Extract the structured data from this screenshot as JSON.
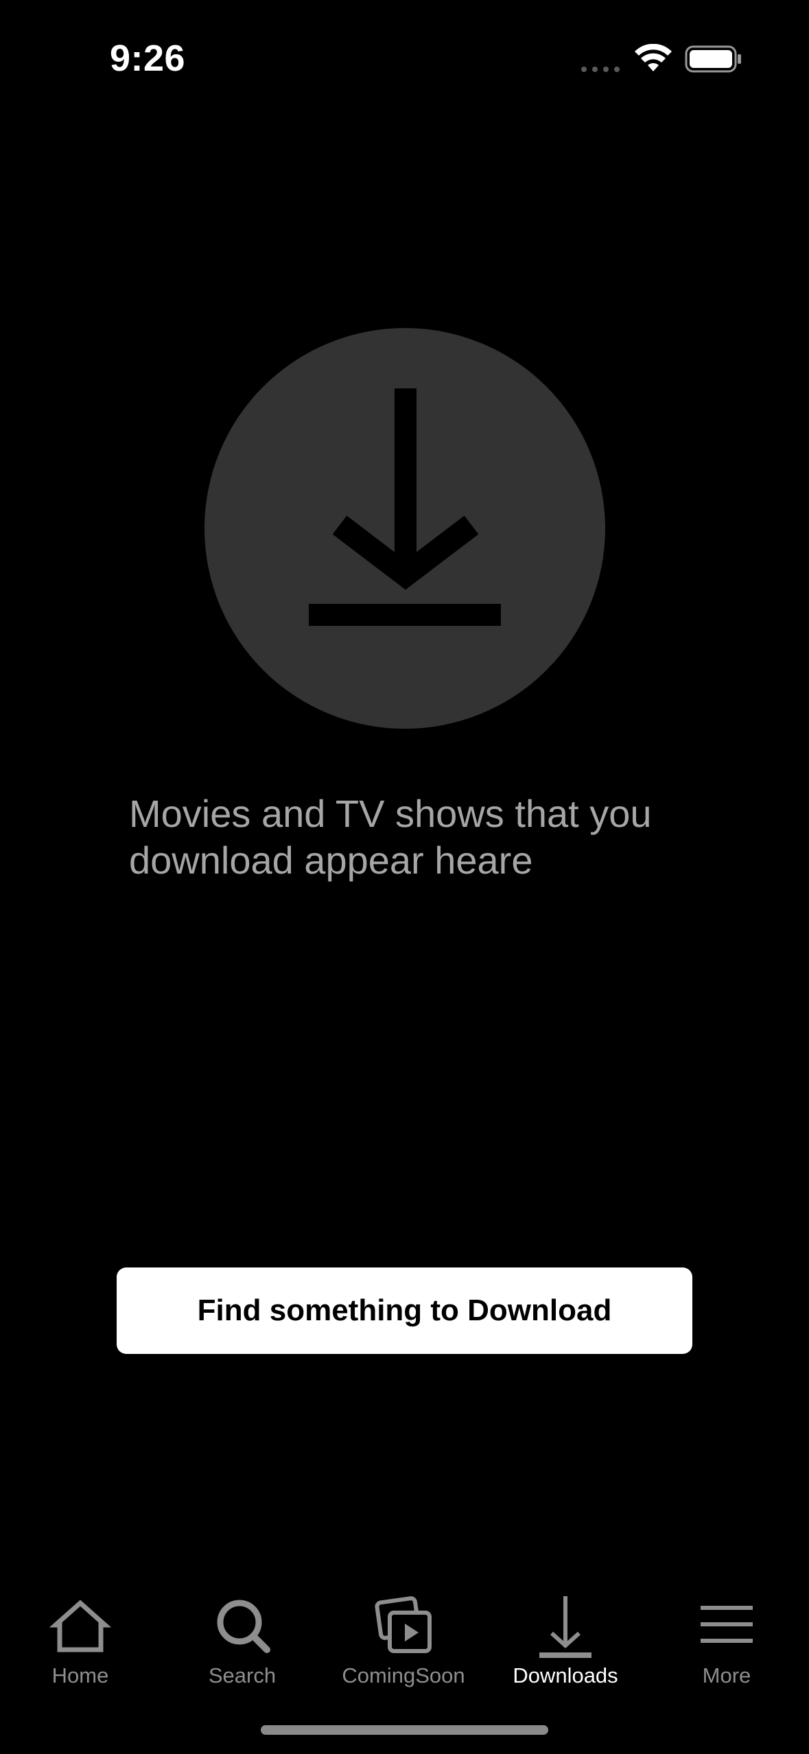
{
  "status_bar": {
    "time": "9:26"
  },
  "empty_state": {
    "icon": "download-icon",
    "message": "Movies and TV shows that you download appear heare"
  },
  "cta": {
    "label": "Find something to Download"
  },
  "tab_bar": {
    "items": [
      {
        "label": "Home",
        "icon": "home-icon",
        "active": false
      },
      {
        "label": "Search",
        "icon": "search-icon",
        "active": false
      },
      {
        "label": "ComingSoon",
        "icon": "coming-soon-icon",
        "active": false
      },
      {
        "label": "Downloads",
        "icon": "download-icon",
        "active": true
      },
      {
        "label": "More",
        "icon": "menu-icon",
        "active": false
      }
    ]
  },
  "colors": {
    "background": "#000000",
    "circle": "#333333",
    "message_text": "#a6a6a6",
    "tab_inactive": "#8e8e8e",
    "tab_active": "#ffffff",
    "button_bg": "#ffffff",
    "button_text": "#000000"
  }
}
